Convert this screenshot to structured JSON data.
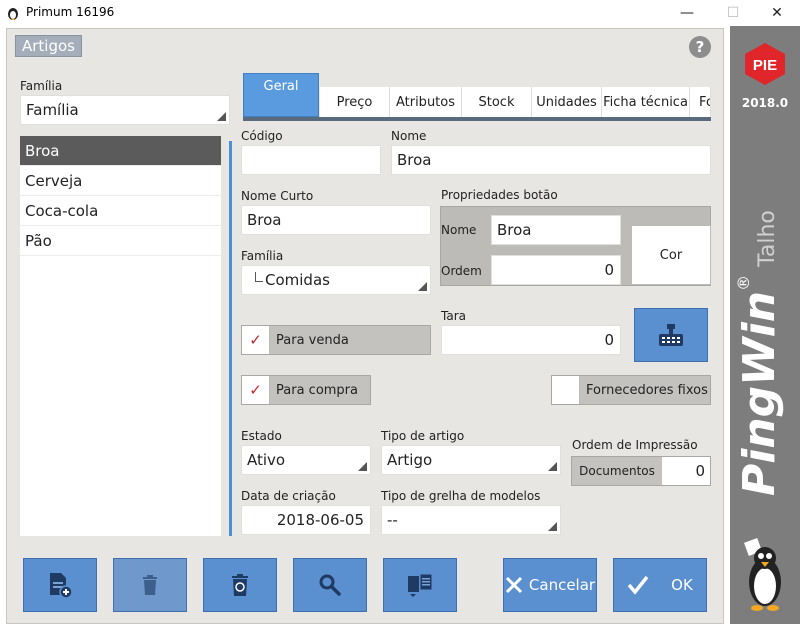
{
  "window": {
    "title": "Primum 16196",
    "minimize": "—",
    "maximize": "☐",
    "close": "✕"
  },
  "brand": {
    "logo_text": "PIE",
    "version": "2018.0",
    "product": "PingWin",
    "reg_mark": "®",
    "edition": "Talho"
  },
  "dialog": {
    "title": "Artigos",
    "help_label": "?"
  },
  "familia_filter": {
    "label": "Família",
    "value": "Família"
  },
  "family_list": [
    "Broa",
    "Cerveja",
    "Coca-cola",
    "Pão"
  ],
  "tabs": [
    "Geral",
    "Preço",
    "Atributos",
    "Stock",
    "Unidades",
    "Ficha técnica",
    "Fo"
  ],
  "form": {
    "codigo_label": "Código",
    "codigo_value": "",
    "nome_label": "Nome",
    "nome_value": "Broa",
    "nome_curto_label": "Nome Curto",
    "nome_curto_value": "Broa",
    "propriedades_label": "Propriedades botão",
    "prop_nome_label": "Nome",
    "prop_nome_value": "Broa",
    "prop_ordem_label": "Ordem",
    "prop_ordem_value": "0",
    "cor_label": "Cor",
    "familia_label": "Família",
    "familia_value": "Comidas",
    "tara_label": "Tara",
    "tara_value": "0",
    "para_venda_label": "Para venda",
    "para_venda_check": "✓",
    "para_compra_label": "Para compra",
    "para_compra_check": "✓",
    "fornecedores_label": "Fornecedores fixos",
    "estado_label": "Estado",
    "estado_value": "Ativo",
    "tipo_artigo_label": "Tipo de artigo",
    "tipo_artigo_value": "Artigo",
    "ordem_impressao_label": "Ordem de Impressão",
    "documentos_label": "Documentos",
    "documentos_value": "0",
    "data_criacao_label": "Data de criação",
    "data_criacao_value": "2018-06-05",
    "tipo_grelha_label": "Tipo de grelha de modelos",
    "tipo_grelha_value": "--"
  },
  "toolbar": {
    "cancel_label": "Cancelar",
    "ok_label": "OK"
  },
  "colors": {
    "accent": "#5a8fd0",
    "tab_active": "#5a9be0",
    "brand_strip": "#7d7d7d",
    "logo_red": "#e0262a"
  }
}
